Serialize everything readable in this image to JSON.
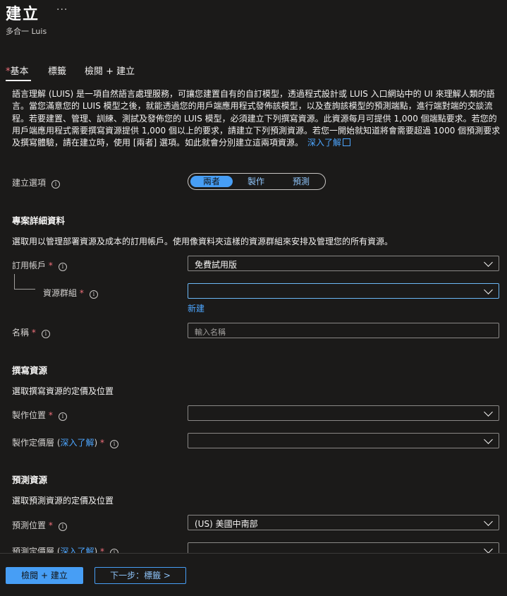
{
  "header": {
    "title": "建立",
    "more": "···",
    "subtitle": "多合一 Luis"
  },
  "tabs": [
    {
      "label": "基本",
      "required": true,
      "selected": true
    },
    {
      "label": "標籤"
    },
    {
      "label": "檢閱 + 建立"
    }
  ],
  "description": {
    "text": "語言理解 (LUIS) 是一項自然語言處理服務，可讓您建置自有的自訂模型，透過程式設計或 LUIS 入口網站中的 UI 來理解人類的語言。當您滿意您的 LUIS 模型之後，就能透過您的用戶端應用程式發佈該模型，以及查詢該模型的預測端點，進行端對端的交談流程。若要建置、管理、訓練、測試及發佈您的 LUIS 模型，必須建立下列撰寫資源。此資源每月可提供 1,000 個端點要求。若您的用戶端應用程式需要撰寫資源提供 1,000 個以上的要求，請建立下列預測資源。若您一開始就知道將會需要超過 1000 個預測要求及撰寫體驗，請在建立時，使用 [兩者] 選項。如此就會分別建立這兩項資源。",
    "link": "深入了解"
  },
  "create_option": {
    "label": "建立選項",
    "options": [
      "兩者",
      "製作",
      "預測"
    ],
    "selected": "兩者"
  },
  "project_details": {
    "heading": "專案詳細資料",
    "description": "選取用以管理部署資源及成本的訂用帳戶。使用像資料夾這樣的資源群組來安排及管理您的所有資源。",
    "subscription_label": "訂用帳戶",
    "subscription_value": "免費試用版",
    "resource_group_label": "資源群組",
    "resource_group_value": "",
    "create_new": "新建"
  },
  "name_field": {
    "label": "名稱",
    "placeholder": "輸入名稱"
  },
  "authoring": {
    "heading": "撰寫資源",
    "description": "選取撰寫資源的定價及位置",
    "location_label": "製作位置",
    "location_value": "",
    "tier_label_prefix": "製作定價層 (",
    "tier_link": "深入了解",
    "tier_label_suffix": ")",
    "tier_value": ""
  },
  "prediction": {
    "heading": "預測資源",
    "description": "選取預測資源的定價及位置",
    "location_label": "預測位置",
    "location_value": "(US) 美國中南部",
    "tier_label_prefix": "預測定價層 (",
    "tier_link": "深入了解",
    "tier_label_suffix": ")"
  },
  "footer": {
    "review_create": "檢閱 + 建立",
    "next": "下一步：標籤 >"
  }
}
